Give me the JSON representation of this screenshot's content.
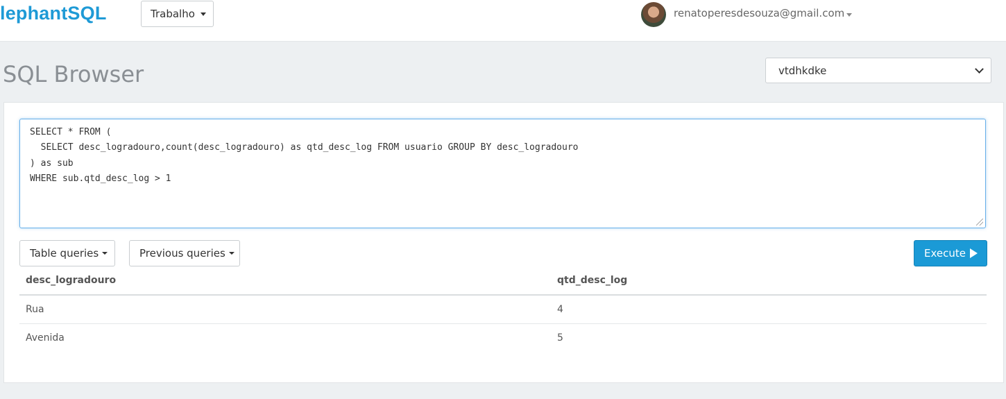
{
  "header": {
    "brand": "lephantSQL",
    "team_label": "Trabalho",
    "user_email": "renatoperesdesouza@gmail.com",
    "avatar_icon": "user-avatar"
  },
  "page": {
    "title": "SQL Browser",
    "database_selected": "vtdhkdke"
  },
  "editor": {
    "lines": [
      "SELECT * FROM (",
      "  SELECT desc_logradouro,count(desc_logradouro) as qtd_desc_log FROM usuario GROUP BY desc_logradouro",
      ") as sub",
      "WHERE sub.qtd_desc_log > 1"
    ]
  },
  "toolbar": {
    "table_queries": "Table queries",
    "previous_queries": "Previous queries",
    "execute": "Execute",
    "execute_color": "#1b9ad6"
  },
  "results": {
    "columns": [
      "desc_logradouro",
      "qtd_desc_log"
    ],
    "rows": [
      [
        "Rua",
        "4"
      ],
      [
        "Avenida",
        "5"
      ]
    ]
  }
}
